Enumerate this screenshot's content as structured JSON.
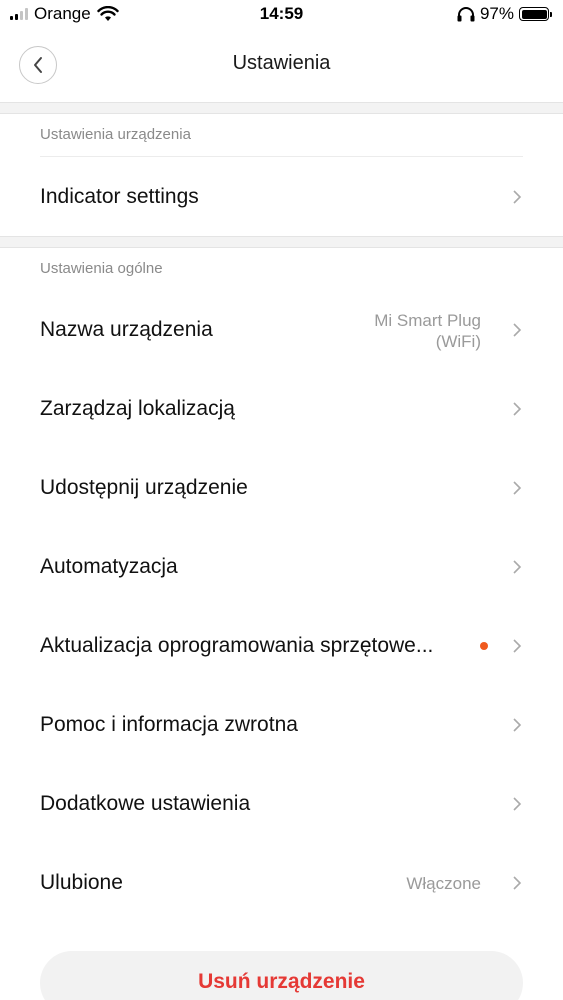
{
  "status_bar": {
    "carrier": "Orange",
    "time": "14:59",
    "battery_percent": "97%"
  },
  "nav": {
    "title": "Ustawienia"
  },
  "device_section": {
    "header": "Ustawienia urządzenia",
    "items": [
      {
        "label": "Indicator settings"
      }
    ]
  },
  "general_section": {
    "header": "Ustawienia ogólne",
    "items": [
      {
        "label": "Nazwa urządzenia",
        "value_line1": "Mi Smart Plug",
        "value_line2": "(WiFi)"
      },
      {
        "label": "Zarządzaj lokalizacją"
      },
      {
        "label": "Udostępnij urządzenie"
      },
      {
        "label": "Automatyzacja"
      },
      {
        "label": "Aktualizacja oprogramowania sprzętowe...",
        "badge": "update-dot"
      },
      {
        "label": "Pomoc i informacja zwrotna"
      },
      {
        "label": "Dodatkowe ustawienia"
      },
      {
        "label": "Ulubione",
        "value": "Włączone"
      }
    ]
  },
  "actions": {
    "delete_label": "Usuń urządzenie"
  },
  "colors": {
    "accent_red": "#e53935",
    "badge_orange": "#f05a1e"
  }
}
